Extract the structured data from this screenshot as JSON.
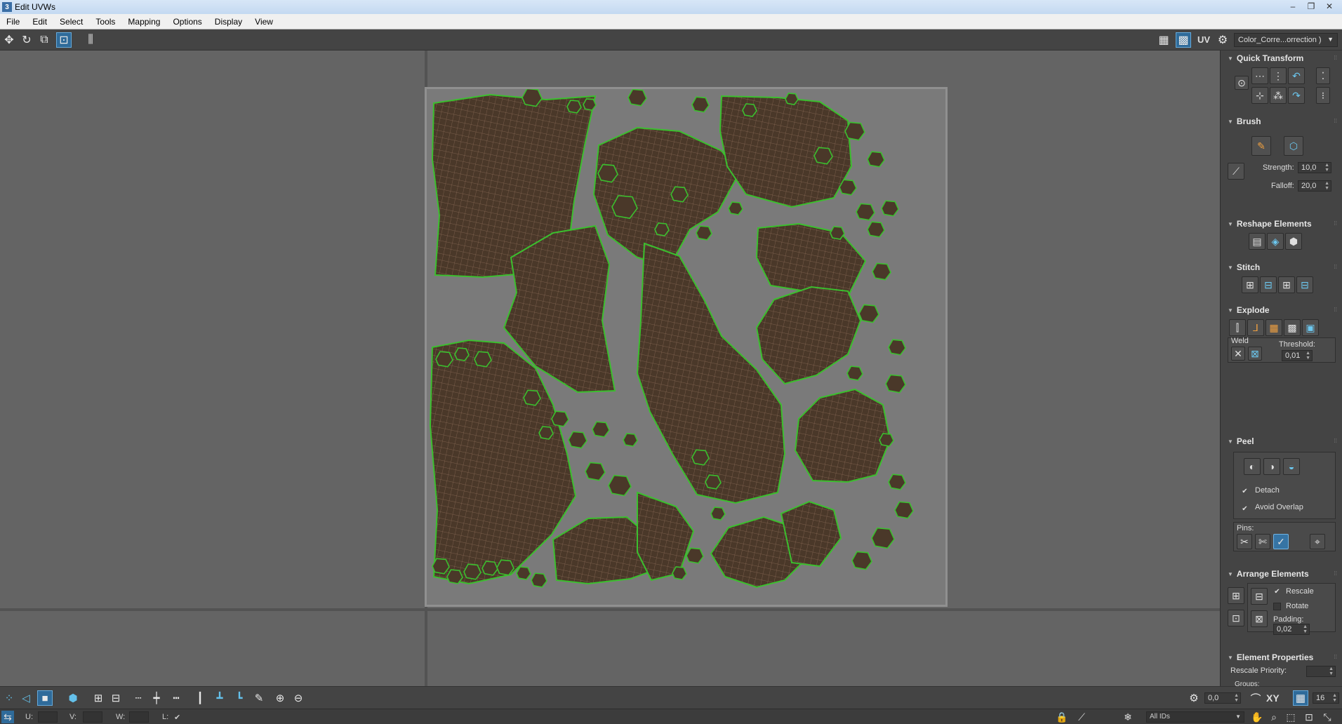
{
  "window": {
    "app_icon": "3",
    "title": "Edit UVWs",
    "controls": {
      "minimize": "–",
      "restore": "❐",
      "close": "✕"
    }
  },
  "menu": [
    "File",
    "Edit",
    "Select",
    "Tools",
    "Mapping",
    "Options",
    "Display",
    "View"
  ],
  "toolbar": {
    "left_tools": [
      "move-icon",
      "rotate-icon",
      "scale-icon",
      "freeform-icon",
      "mirror-icon"
    ],
    "uv_label": "UV",
    "texture_dropdown": "Color_Corre...orrection )"
  },
  "viewport": {
    "uv_tile_background": "#7a7a7a",
    "shell_fill": "#4a3829",
    "shell_outline": "#3bbf2e",
    "mesh_color": "#8a6a56"
  },
  "panel": {
    "quick_transform": {
      "title": "Quick Transform"
    },
    "brush": {
      "title": "Brush",
      "strength_label": "Strength:",
      "strength_value": "10,0",
      "falloff_label": "Falloff:",
      "falloff_value": "20,0"
    },
    "reshape": {
      "title": "Reshape Elements"
    },
    "stitch": {
      "title": "Stitch"
    },
    "explode": {
      "title": "Explode",
      "weld_label": "Weld",
      "threshold_label": "Threshold:",
      "threshold_value": "0,01"
    },
    "peel": {
      "title": "Peel",
      "detach_label": "Detach",
      "detach_checked": true,
      "avoid_overlap_label": "Avoid Overlap",
      "avoid_overlap_checked": true,
      "pins_label": "Pins:"
    },
    "arrange": {
      "title": "Arrange Elements",
      "rescale_label": "Rescale",
      "rescale_checked": true,
      "rotate_label": "Rotate",
      "rotate_checked": false,
      "padding_label": "Padding:",
      "padding_value": "0,02"
    },
    "element_props": {
      "title": "Element Properties",
      "rescale_priority_label": "Rescale Priority:",
      "groups_label": "Groups:"
    }
  },
  "bottombar": {
    "angle_value": "0,0",
    "xy_label": "XY",
    "grid_value": "16"
  },
  "status": {
    "u_label": "U:",
    "v_label": "V:",
    "w_label": "W:",
    "l_label": "L:",
    "ids_dropdown": "All IDs"
  }
}
